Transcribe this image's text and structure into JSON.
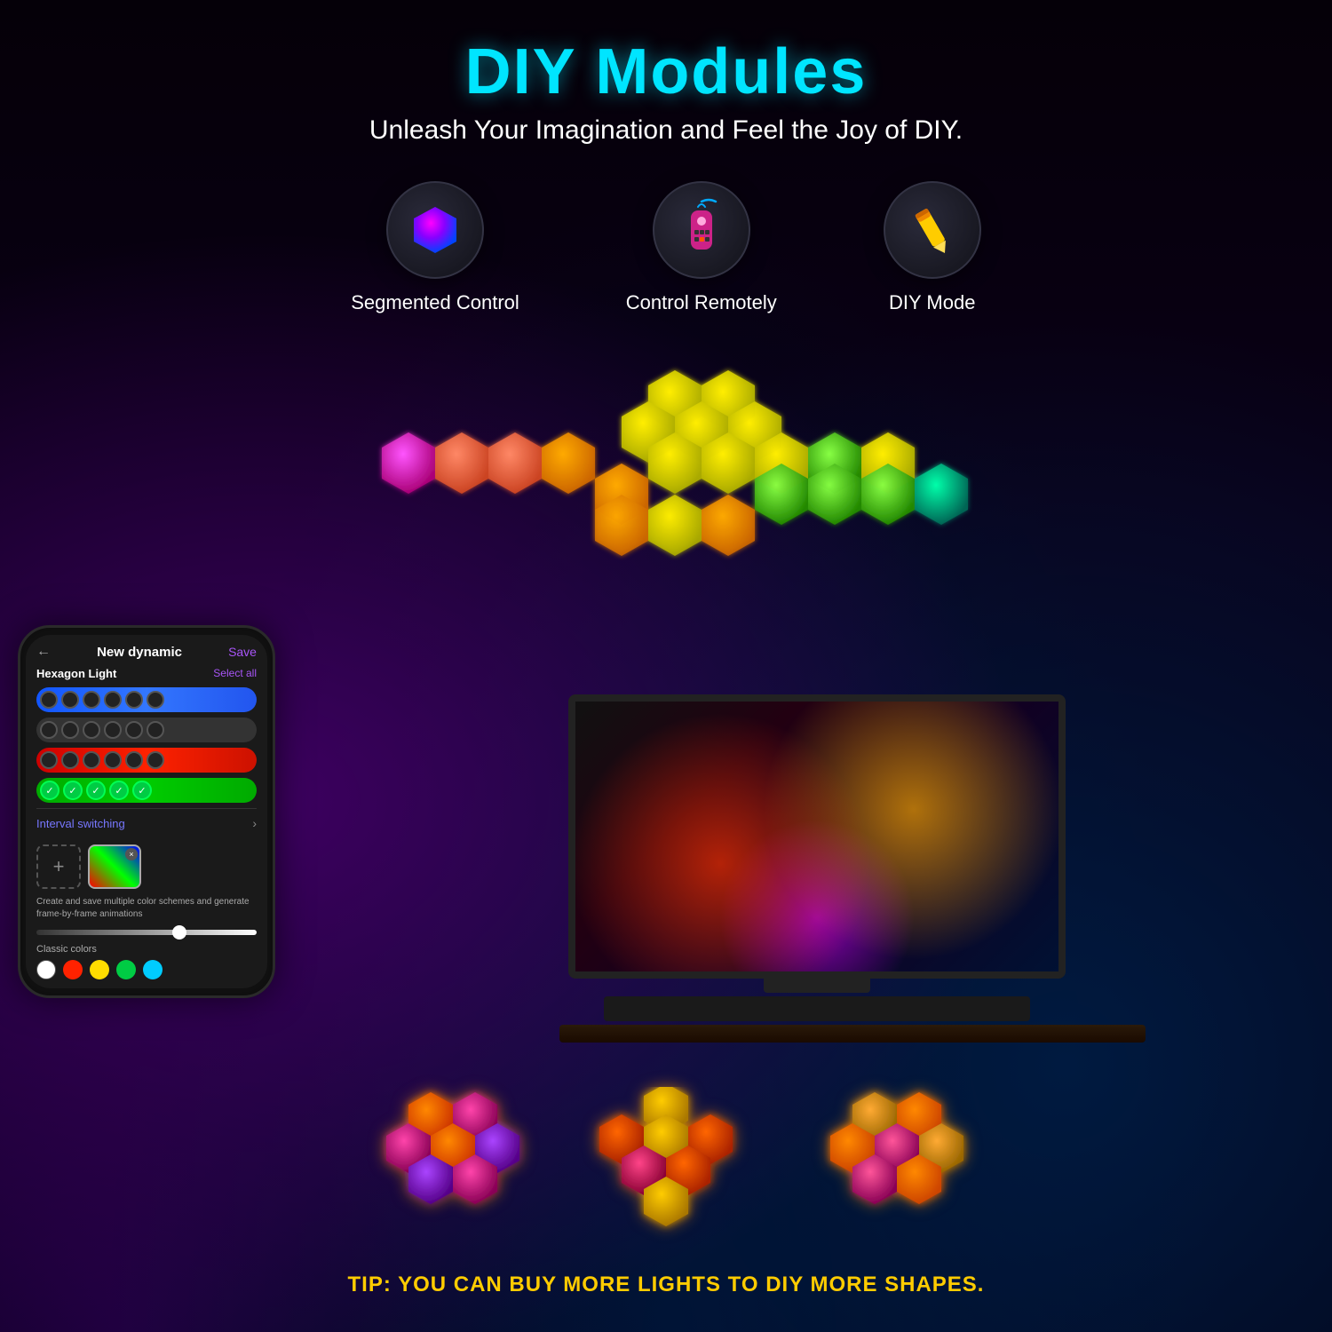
{
  "header": {
    "main_title": "DIY Modules",
    "subtitle": "Unleash Your Imagination and Feel the Joy of DIY."
  },
  "features": [
    {
      "id": "segmented-control",
      "label": "Segmented Control",
      "icon": "hexagon"
    },
    {
      "id": "control-remotely",
      "label": "Control Remotely",
      "icon": "remote"
    },
    {
      "id": "diy-mode",
      "label": "DIY Mode",
      "icon": "pencil"
    }
  ],
  "phone": {
    "back_arrow": "←",
    "title": "New dynamic",
    "save_label": "Save",
    "section_label": "Hexagon Light",
    "select_all_label": "Select all",
    "interval_label": "Interval switching",
    "scheme_desc": "Create and save multiple color schemes and generate frame-by-frame animations",
    "classic_label": "Classic colors",
    "brightness_pct": 65
  },
  "classic_colors": [
    "#ffffff",
    "#ff2200",
    "#ffdd00",
    "#00cc44",
    "#00ccff"
  ],
  "tip_text": "TIP: YOU CAN BUY MORE LIGHTS TO DIY MORE SHAPES."
}
